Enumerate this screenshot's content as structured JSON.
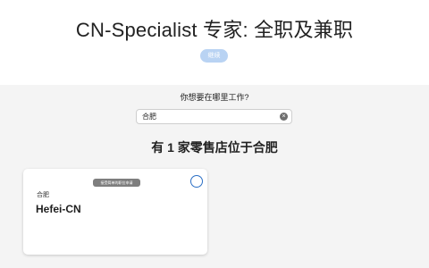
{
  "header": {
    "title": "CN-Specialist 专家: 全职及兼职",
    "continue_label": "继续"
  },
  "location": {
    "question": "你想要在哪里工作?",
    "search_value": "合肥",
    "clear_icon": "clear-icon"
  },
  "results": {
    "count_text": "有 1 家零售店位于合肥"
  },
  "stores": [
    {
      "badge": "接受简单的职位申请",
      "city": "合肥",
      "name": "Hefei-CN",
      "selected": false
    }
  ],
  "colors": {
    "accent": "#2b6fc5",
    "continue_disabled": "#b9d3f3",
    "panel_bg": "#f4f4f4"
  }
}
